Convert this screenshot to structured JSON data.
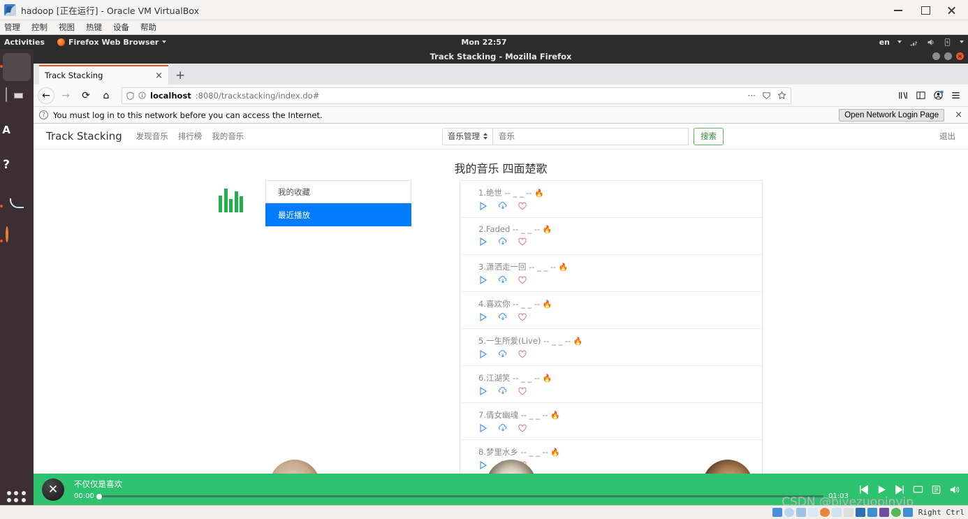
{
  "vbox": {
    "title": "hadoop [正在运行] - Oracle VM VirtualBox",
    "menu": [
      "管理",
      "控制",
      "视图",
      "热键",
      "设备",
      "帮助"
    ],
    "host_key": "Right Ctrl"
  },
  "ubuntu": {
    "activities": "Activities",
    "app_name": "Firefox Web Browser",
    "clock": "Mon 22:57",
    "language": "en"
  },
  "firefox": {
    "window_title": "Track Stacking - Mozilla Firefox",
    "tab_title": "Track Stacking",
    "tab_close": "×",
    "new_tab": "+",
    "nav": {
      "back": "←",
      "forward": "→",
      "reload": "⟳",
      "home": "⌂"
    },
    "url_host": "localhost",
    "url_rest": ":8080/trackstacking/index.do#",
    "notification": {
      "text": "You must log in to this network before you can access the Internet.",
      "button": "Open Network Login Page",
      "close": "×"
    }
  },
  "site": {
    "brand": "Track Stacking",
    "nav_links": [
      {
        "label": "发现音乐"
      },
      {
        "label": "排行榜"
      },
      {
        "label": "我的音乐"
      }
    ],
    "search": {
      "category": "音乐管理",
      "placeholder": "音乐",
      "value": "",
      "button": "搜索"
    },
    "logout": "退出",
    "heading": "我的音乐 四面楚歌",
    "left_panel": [
      {
        "label": "我的收藏",
        "active": false
      },
      {
        "label": "最近播放",
        "active": true
      }
    ],
    "songs": [
      {
        "title": "1.绝世 -- _ _ --"
      },
      {
        "title": "2.Faded -- _ _ --"
      },
      {
        "title": "3.潇洒走一回 -- _ _ --"
      },
      {
        "title": "4.喜欢你 -- _ _ --"
      },
      {
        "title": "5.一生所爱(Live) -- _ _ --"
      },
      {
        "title": "6.江湖笑 -- _ _ --"
      },
      {
        "title": "7.倩女幽魂 -- _ _ --"
      },
      {
        "title": "8.梦里水乡 -- _ _ --"
      }
    ]
  },
  "player": {
    "track_title": "不仅仅是喜欢",
    "current_time": "00:00",
    "duration": "01:03",
    "close": "✕"
  },
  "watermark": "CSDN @biyezuopinvip",
  "colors": {
    "accent_green": "#2fc26e",
    "active_blue": "#027bfd",
    "flame_red": "#e8433a",
    "eq_green": "#21b14c",
    "ubuntu_orange": "#e95420"
  }
}
